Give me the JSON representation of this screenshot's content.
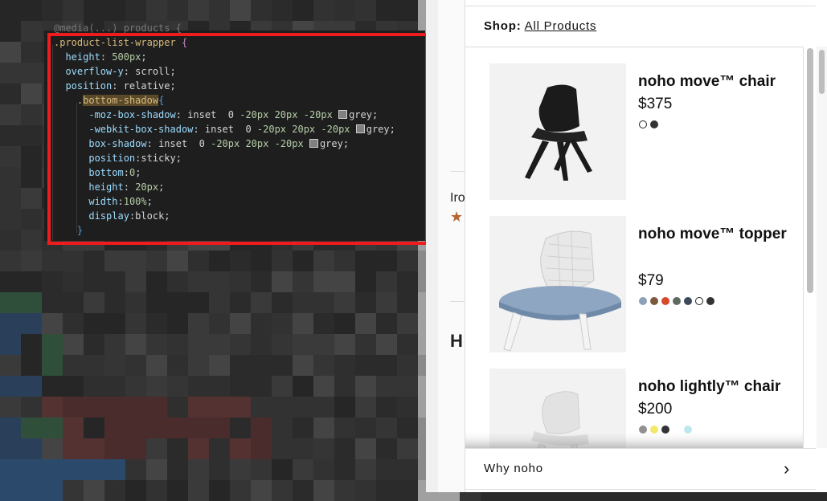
{
  "code": {
    "lines": [
      {
        "t": "@media(...) products {",
        "k": "dim"
      },
      {
        "t": ".product-list-wrapper {",
        "k": "sel"
      },
      {
        "t": "  height: 500px;",
        "k": "decl"
      },
      {
        "t": "  overflow-y: scroll;",
        "k": "decl"
      },
      {
        "t": "  position: relative;",
        "k": "decl"
      },
      {
        "t": "    .bottom-shadow{",
        "k": "sel2"
      },
      {
        "t": "      -moz-box-shadow: inset  0 -20px 20px -20px grey;",
        "k": "shadow"
      },
      {
        "t": "      -webkit-box-shadow: inset  0 -20px 20px -20px grey;",
        "k": "shadow"
      },
      {
        "t": "      box-shadow: inset  0 -20px 20px -20px grey;",
        "k": "shadow"
      },
      {
        "t": "      position:sticky;",
        "k": "decl"
      },
      {
        "t": "      bottom:0;",
        "k": "decl"
      },
      {
        "t": "      height: 20px;",
        "k": "decl"
      },
      {
        "t": "      width:100%;",
        "k": "decl"
      },
      {
        "t": "      display:block;",
        "k": "decl"
      },
      {
        "t": "    }",
        "k": "close"
      }
    ]
  },
  "middle": {
    "text1": "Iro",
    "star": "★",
    "text2": "H"
  },
  "shop": {
    "label": "Shop:",
    "link": "All Products",
    "products": [
      {
        "name": "noho move™ chair",
        "price": "$375",
        "colors": [
          "#ffffff",
          "#333333"
        ],
        "outlined": [
          true,
          false
        ]
      },
      {
        "name": "noho move™ topper",
        "price": "$79",
        "colors": [
          "#8da0b8",
          "#7b5a3c",
          "#d64a2a",
          "#5e6a60",
          "#3c4a5a",
          "#ffffff",
          "#333333"
        ],
        "outlined": [
          false,
          false,
          false,
          false,
          false,
          true,
          false
        ]
      },
      {
        "name": "noho lightly™ chair",
        "price": "$200",
        "colors": [
          "#909090",
          "#f2e86a",
          "#333333",
          "#ffffff",
          "#bfe6ef"
        ],
        "outlined": [
          false,
          false,
          false,
          false,
          false
        ]
      }
    ],
    "why_label": "Why noho",
    "chevron": "›"
  },
  "colors": {
    "highlight_border": "#ee1c1c",
    "editor_bg": "#1e1e1e"
  }
}
